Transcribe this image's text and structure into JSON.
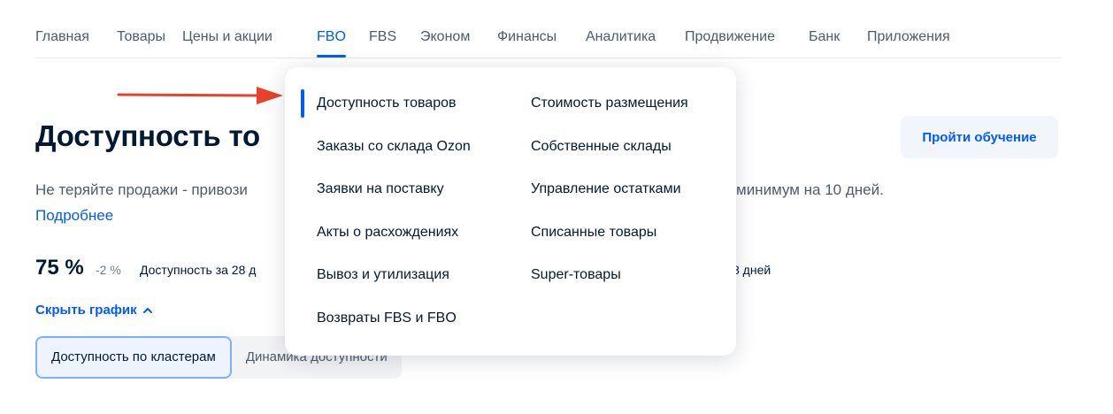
{
  "nav": {
    "items": [
      {
        "label": "Главная"
      },
      {
        "label": "Товары"
      },
      {
        "label": "Цены и акции"
      },
      {
        "label": "FBO",
        "active": true
      },
      {
        "label": "FBS"
      },
      {
        "label": "Эконом"
      },
      {
        "label": "Финансы"
      },
      {
        "label": "Аналитика"
      },
      {
        "label": "Продвижение"
      },
      {
        "label": "Банк"
      },
      {
        "label": "Приложения"
      }
    ]
  },
  "page": {
    "title_visible": "Доступность то",
    "description_start": "Не теряйте продажи - привози",
    "description_end": "минимум на 10 дней.",
    "more_link": "Подробнее",
    "cta_button": "Пройти обучение"
  },
  "stats": {
    "value": "75 %",
    "delta": "-2 %",
    "label_start": "Доступность за 28 д",
    "label_end": "8 дней",
    "hide_chart": "Скрыть график"
  },
  "tabs": [
    {
      "label": "Доступность по кластерам",
      "active": true
    },
    {
      "label": "Динамика доступности",
      "active": false
    }
  ],
  "dropdown": {
    "left_items": [
      {
        "label": "Доступность товаров",
        "active": true
      },
      {
        "label": "Заказы со склада Ozon"
      },
      {
        "label": "Заявки на поставку"
      },
      {
        "label": "Акты о расхождениях"
      },
      {
        "label": "Вывоз и утилизация"
      },
      {
        "label": "Возвраты FBS и FBO"
      }
    ],
    "right_items": [
      {
        "label": "Стоимость размещения"
      },
      {
        "label": "Собственные склады"
      },
      {
        "label": "Управление остатками"
      },
      {
        "label": "Списанные товары"
      },
      {
        "label": "Super-товары"
      }
    ]
  },
  "colors": {
    "accent": "#005bff",
    "annotation_arrow": "#e8412c",
    "text_primary": "#001a34",
    "text_secondary": "#4d5b6b"
  },
  "icons": {
    "chevron": "chevron-up-icon",
    "annotation": "annotation-arrow"
  }
}
